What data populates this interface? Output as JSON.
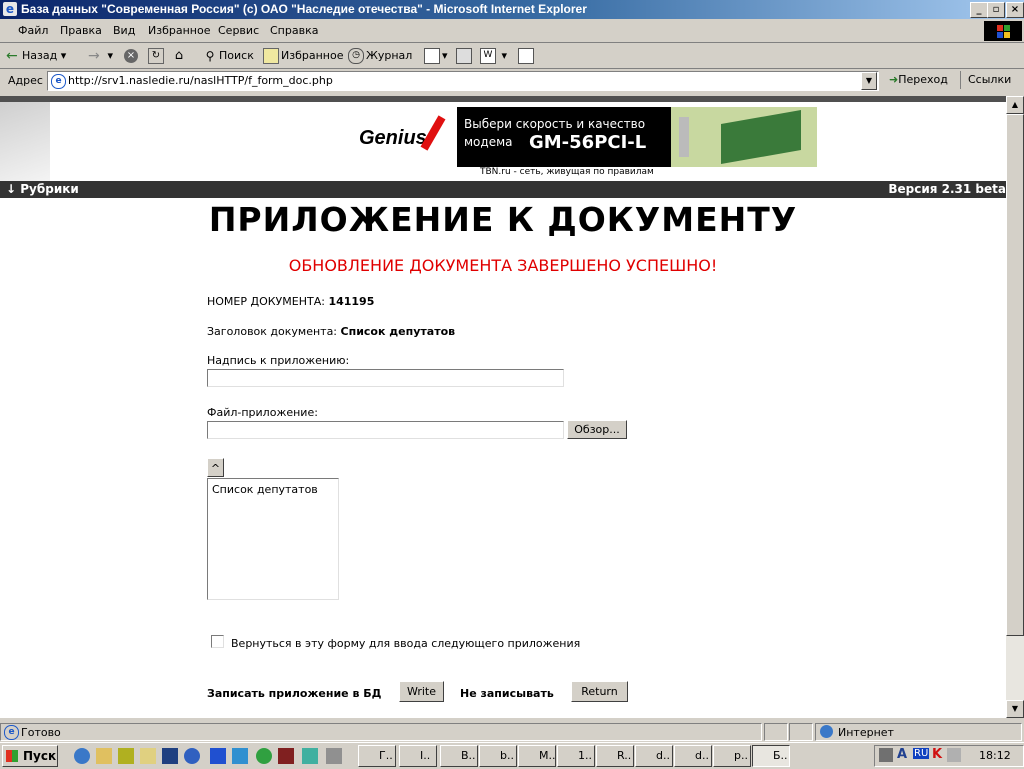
{
  "window": {
    "title": "База данных \"Современная Россия\" (c) ОАО \"Наследие отечества\" - Microsoft Internet Explorer",
    "icon": "ie-icon"
  },
  "menu": {
    "items": [
      "Файл",
      "Правка",
      "Вид",
      "Избранное",
      "Сервис",
      "Справка"
    ]
  },
  "toolbar": {
    "back": "Назад",
    "search": "Поиск",
    "favorites": "Избранное",
    "history": "Журнал"
  },
  "address": {
    "label": "Адрес",
    "url": "http://srv1.nasledie.ru/naslHTTP/f_form_doc.php",
    "go": "Переход",
    "links": "Ссылки"
  },
  "banner": {
    "brand": "Genius",
    "line1": "Выбери скорость и качество",
    "line2": "модема",
    "model": "GM-56PCI-L",
    "caption": "TBN.ru - сеть, живущая по правилам"
  },
  "rubric_bar": {
    "left": "Рубрики",
    "right": "Версия 2.31 beta"
  },
  "main": {
    "heading": "ПРИЛОЖЕНИЕ К ДОКУМЕНТУ",
    "success": "ОБНОВЛЕНИЕ ДОКУМЕНТА ЗАВЕРШЕНО УСПЕШНО!",
    "docnum_label": "НОМЕР ДОКУМЕНТА:",
    "docnum_value": "141195",
    "doctitle_label": "Заголовок документа:",
    "doctitle_value": "Список депутатов",
    "caption_label": "Надпись к приложению:",
    "caption_value": "",
    "file_label": "Файл-приложение:",
    "file_value": "",
    "browse": "Обзор...",
    "up_button": "^",
    "list_items": [
      "Список депутатов"
    ],
    "return_checkbox": "Вернуться в эту форму для ввода следующего приложения",
    "write_label": "Записать приложение в БД",
    "write_button": "Write",
    "no_write_label": "Не записывать",
    "return_button": "Return"
  },
  "status": {
    "left": "Готово",
    "zone": "Интернет"
  },
  "taskbar": {
    "start": "Пуск",
    "tasks": [
      "Г..",
      "I..",
      "В..",
      "b..",
      "M..",
      "1..",
      "R..",
      "d..",
      "d..",
      "p..",
      "Б.."
    ],
    "tray_lang": "RU",
    "time": "18:12"
  }
}
